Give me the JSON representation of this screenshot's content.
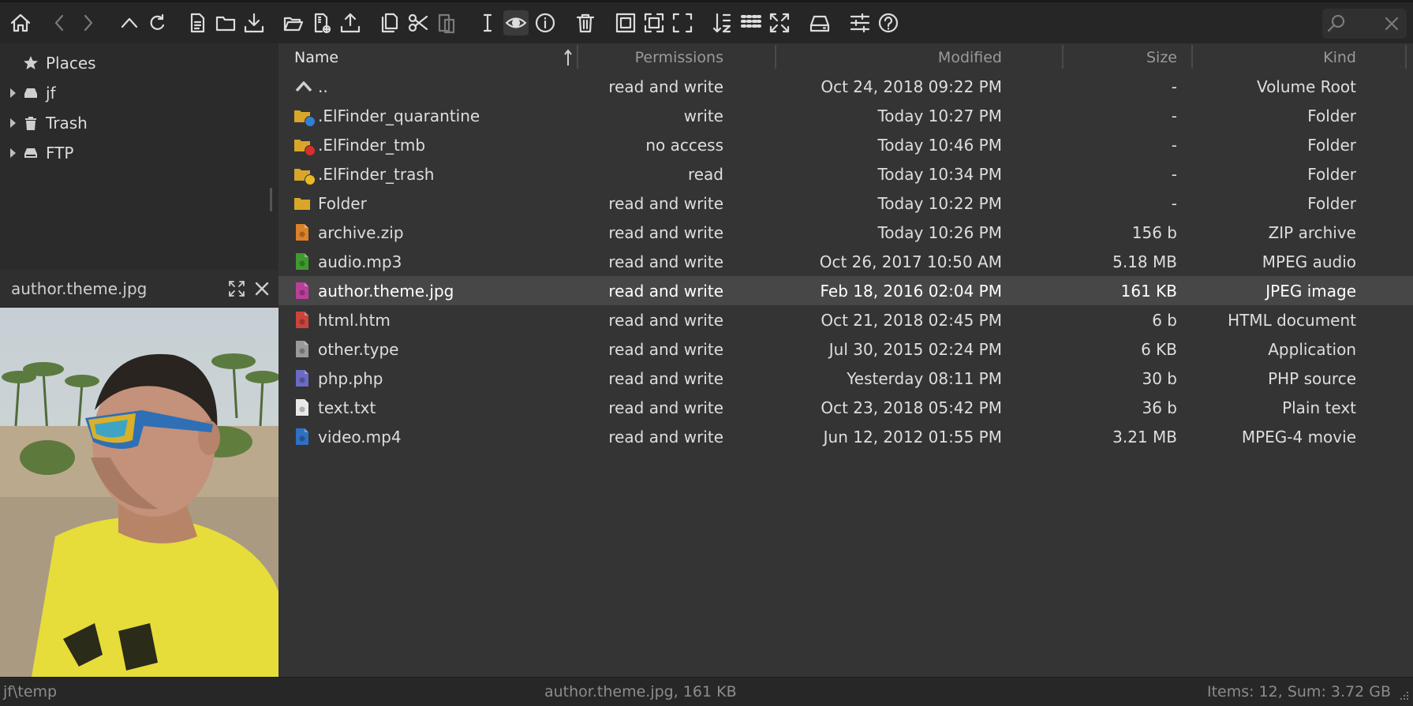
{
  "toolbar": {
    "icons": [
      "home-icon",
      "back-icon",
      "forward-icon",
      "up-icon",
      "reload-icon",
      "new-file-icon",
      "new-folder-icon",
      "download-icon",
      "open-icon",
      "new-archive-icon",
      "upload-icon",
      "copy-icon",
      "cut-icon",
      "paste-icon",
      "rename-icon",
      "preview-icon",
      "info-icon",
      "trash-icon",
      "select-all-icon",
      "select-none-icon",
      "invert-select-icon",
      "sort-icon",
      "view-icon",
      "fullscreen-icon",
      "netmount-icon",
      "preferences-icon",
      "help-icon",
      "search-icon",
      "close-icon"
    ]
  },
  "search": {
    "value": ""
  },
  "sidebar": {
    "places": "Places",
    "items": [
      {
        "label": "jf",
        "icon": "drive-icon"
      },
      {
        "label": "Trash",
        "icon": "trash-icon"
      },
      {
        "label": "FTP",
        "icon": "network-drive-icon"
      }
    ]
  },
  "preview": {
    "title": "author.theme.jpg"
  },
  "columns": {
    "name": "Name",
    "permissions": "Permissions",
    "modified": "Modified",
    "size": "Size",
    "kind": "Kind"
  },
  "files": [
    {
      "name": "..",
      "permissions": "read and write",
      "modified": "Oct 24, 2018 09:22 PM",
      "size": "-",
      "kind": "Volume Root",
      "icon": "parent-dir-icon",
      "color": "#cfcfcf"
    },
    {
      "name": ".ElFinder_quarantine",
      "permissions": "write",
      "modified": "Today 10:27 PM",
      "size": "-",
      "kind": "Folder",
      "icon": "folder-icon",
      "color": "#d9a62a",
      "badge": "#2f7fd6"
    },
    {
      "name": ".ElFinder_tmb",
      "permissions": "no access",
      "modified": "Today 10:46 PM",
      "size": "-",
      "kind": "Folder",
      "icon": "folder-icon",
      "color": "#d9a62a",
      "badge": "#d62f2f"
    },
    {
      "name": ".ElFinder_trash",
      "permissions": "read",
      "modified": "Today 10:34 PM",
      "size": "-",
      "kind": "Folder",
      "icon": "folder-icon",
      "color": "#d9a62a",
      "badge": "#e8b923"
    },
    {
      "name": "Folder",
      "permissions": "read and write",
      "modified": "Today 10:22 PM",
      "size": "-",
      "kind": "Folder",
      "icon": "folder-icon",
      "color": "#d9a62a"
    },
    {
      "name": "archive.zip",
      "permissions": "read and write",
      "modified": "Today 10:26 PM",
      "size": "156 b",
      "kind": "ZIP archive",
      "icon": "archive-icon",
      "color": "#d9822a"
    },
    {
      "name": "audio.mp3",
      "permissions": "read and write",
      "modified": "Oct 26, 2017 10:50 AM",
      "size": "5.18 MB",
      "kind": "MPEG audio",
      "icon": "audio-file-icon",
      "color": "#3f9a2f"
    },
    {
      "name": "author.theme.jpg",
      "permissions": "read and write",
      "modified": "Feb 18, 2016 02:04 PM",
      "size": "161 KB",
      "kind": "JPEG image",
      "icon": "image-file-icon",
      "color": "#b8409a",
      "selected": true
    },
    {
      "name": "html.htm",
      "permissions": "read and write",
      "modified": "Oct 21, 2018 02:45 PM",
      "size": "6 b",
      "kind": "HTML document",
      "icon": "html-file-icon",
      "color": "#c9453b"
    },
    {
      "name": "other.type",
      "permissions": "read and write",
      "modified": "Jul 30, 2015 02:24 PM",
      "size": "6 KB",
      "kind": "Application",
      "icon": "generic-file-icon",
      "color": "#9a9a9a"
    },
    {
      "name": "php.php",
      "permissions": "read and write",
      "modified": "Yesterday 08:11 PM",
      "size": "30 b",
      "kind": "PHP source",
      "icon": "php-file-icon",
      "color": "#6b6bc4"
    },
    {
      "name": "text.txt",
      "permissions": "read and write",
      "modified": "Oct 23, 2018 05:42 PM",
      "size": "36 b",
      "kind": "Plain text",
      "icon": "text-file-icon",
      "color": "#e8e8e8"
    },
    {
      "name": "video.mp4",
      "permissions": "read and write",
      "modified": "Jun 12, 2012 01:55 PM",
      "size": "3.21 MB",
      "kind": "MPEG-4 movie",
      "icon": "video-file-icon",
      "color": "#2f6fc4"
    }
  ],
  "status": {
    "path": "jf\\temp",
    "selection": "author.theme.jpg, 161 KB",
    "summary": "Items: 12, Sum: 3.72 GB"
  }
}
